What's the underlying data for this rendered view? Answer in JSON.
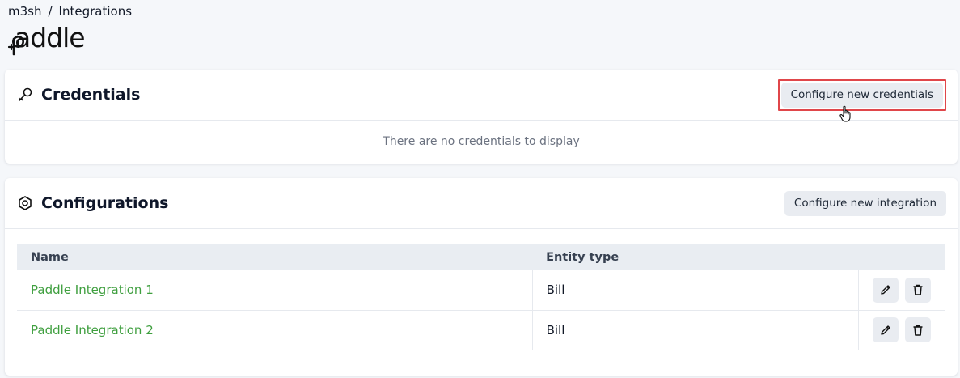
{
  "breadcrumb": {
    "org": "m3sh",
    "separator": "/",
    "page": "Integrations"
  },
  "logo": {
    "text": "paddle"
  },
  "credentials": {
    "title": "Credentials",
    "button_label": "Configure new credentials",
    "empty_message": "There are no credentials to display"
  },
  "configurations": {
    "title": "Configurations",
    "button_label": "Configure new integration",
    "columns": {
      "name": "Name",
      "entity_type": "Entity type"
    },
    "rows": [
      {
        "name": "Paddle Integration 1",
        "entity_type": "Bill"
      },
      {
        "name": "Paddle Integration 2",
        "entity_type": "Bill"
      }
    ]
  },
  "colors": {
    "accent_link": "#3f9f3f",
    "highlight_border": "#e0464a",
    "button_bg": "#e9ecf1"
  },
  "icons": {
    "credentials": "key-icon",
    "configurations": "hexagon-nut-icon",
    "edit": "pencil-icon",
    "delete": "trash-icon",
    "cursor": "hand-pointer-icon"
  }
}
